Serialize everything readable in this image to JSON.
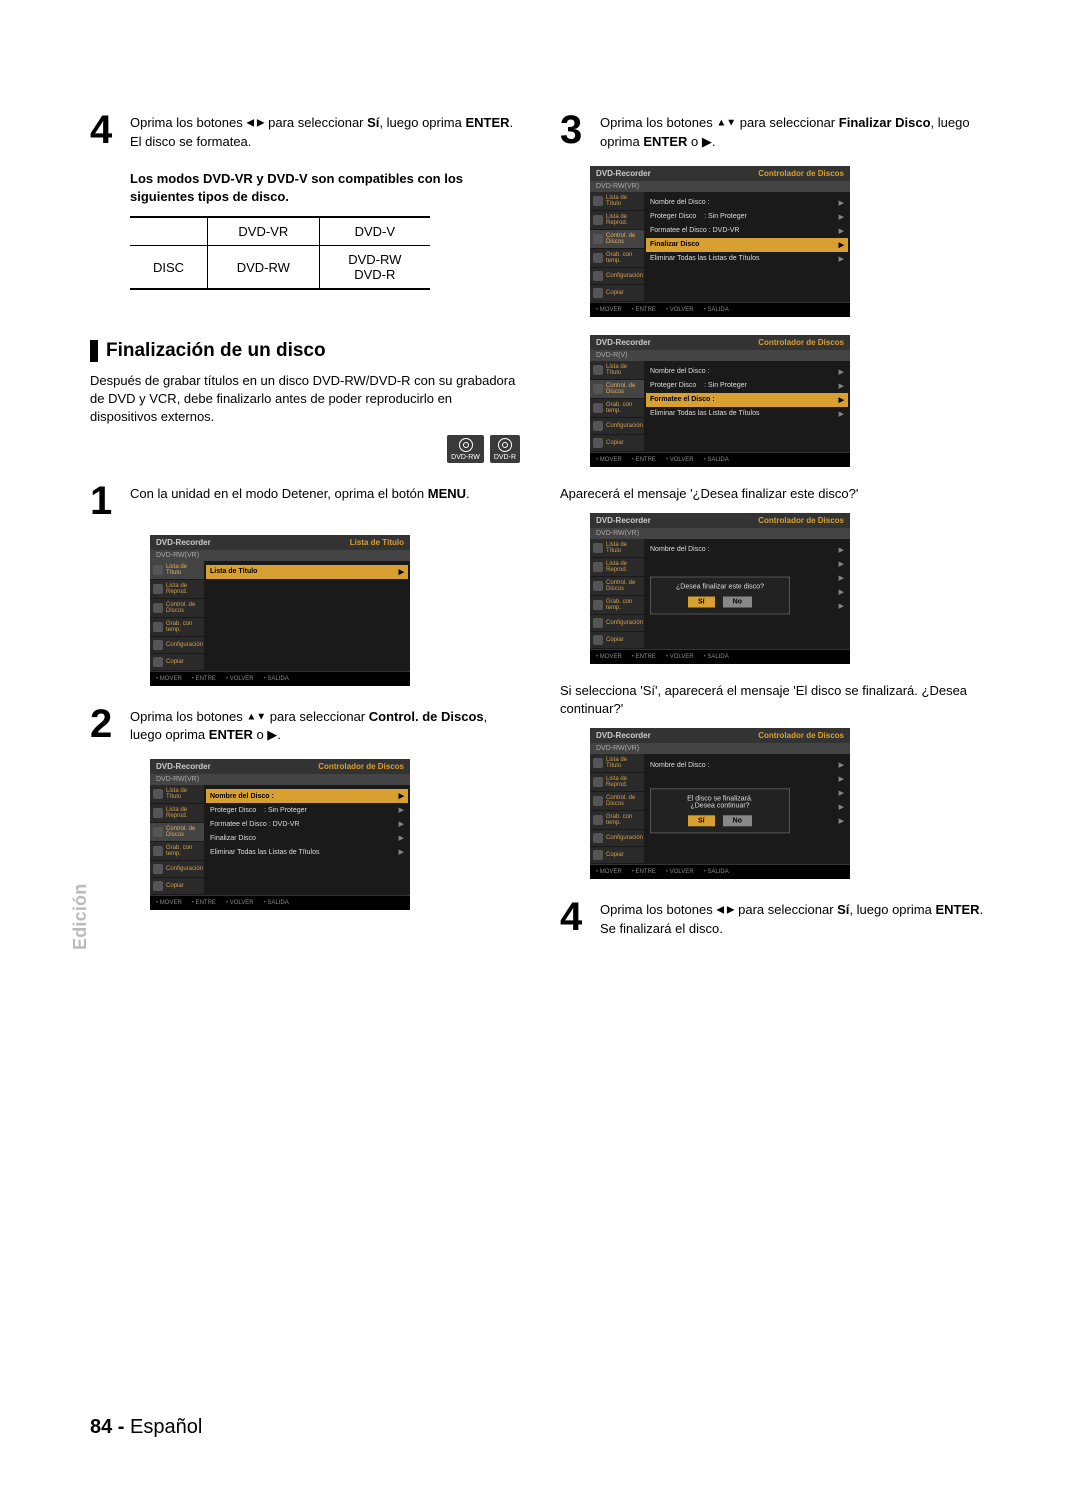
{
  "sideTab": "Edición",
  "footer": {
    "page": "84 -",
    "lang": "Español"
  },
  "left": {
    "step4": {
      "num": "4",
      "pre": "Oprima los botones ",
      "arrows": "◀ ▶",
      "mid": " para seleccionar ",
      "si": "Sí",
      "mid2": ", luego oprima ",
      "enter": "ENTER",
      "post": ". El disco se formatea."
    },
    "note": "Los modos DVD-VR y DVD-V son compatibles con los siguientes tipos de disco.",
    "table": {
      "h1": "DVD-VR",
      "h2": "DVD-V",
      "r1c1": "DISC",
      "r1c2": "DVD-RW",
      "r1c3a": "DVD-RW",
      "r1c3b": "DVD-R"
    },
    "section": "Finalización de un disco",
    "intro": "Después de grabar títulos en un disco DVD-RW/DVD-R con su grabadora de DVD y VCR, debe finalizarlo antes de poder reproducirlo en dispositivos externos.",
    "chip1": "DVD-RW",
    "chip2": "DVD-R",
    "step1": {
      "num": "1",
      "pre": "Con la unidad en el modo Detener, oprima el botón ",
      "menu": "MENU",
      "post": "."
    },
    "step2": {
      "num": "2",
      "pre": "Oprima los botones ",
      "arrows": "▲▼",
      "mid": " para seleccionar ",
      "ctrl": "Control. de Discos",
      "mid2": ", luego oprima ",
      "enter": "ENTER",
      "post": " o ▶."
    }
  },
  "right": {
    "step3": {
      "num": "3",
      "pre": "Oprima los botones ",
      "arrows": "▲▼",
      "mid": " para seleccionar ",
      "fin": "Finalizar Disco",
      "mid2": ", luego oprima  ",
      "enter": "ENTER",
      "post": " o ▶."
    },
    "msg1": "Aparecerá el mensaje '¿Desea finalizar este disco?'",
    "msg2": "Si selecciona 'Sí', aparecerá el mensaje 'El disco se finalizará. ¿Desea continuar?'",
    "step4": {
      "num": "4",
      "pre": "Oprima los botones ",
      "arrows": "◀ ▶",
      "mid": "para seleccionar ",
      "si": "Sí",
      "mid2": ", luego oprima ",
      "enter": "ENTER",
      "post": ".",
      "final": "Se finalizará el disco."
    }
  },
  "osd": {
    "recorder": "DVD-Recorder",
    "listTitle": "Lista de Título",
    "ctrl": "Controlador de Discos",
    "subVR": "DVD-RW(VR)",
    "subV": "DVD-R(V)",
    "side": {
      "lista": "Lista de Título",
      "rep": "Lista de Reprod.",
      "ctrl": "Control. de Discos",
      "grab": "Grab. con temp.",
      "conf": "Configuración",
      "cop": "Copiar"
    },
    "rows": {
      "lista": "Lista de Título",
      "nombre": "Nombre del Disco   :",
      "prot": "Proteger Disco",
      "protVal": ": Sin Proteger",
      "form": "Formatee el Disco : DVD-VR",
      "form2": "Formatee el Disco   :",
      "fin": "Finalizar Disco",
      "elim": "Eliminar Todas las Listas de Títulos"
    },
    "foot": {
      "mover": "MOVER",
      "entre": "ENTRE",
      "volver": "VOLVER",
      "salida": "SALIDA"
    },
    "dlg1": {
      "q": "¿Desea finalizar este disco?",
      "si": "Sí",
      "no": "No"
    },
    "dlg2": {
      "l1": "El disco se finalizará.",
      "l2": "¿Desea continuar?",
      "si": "Sí",
      "no": "No"
    }
  }
}
